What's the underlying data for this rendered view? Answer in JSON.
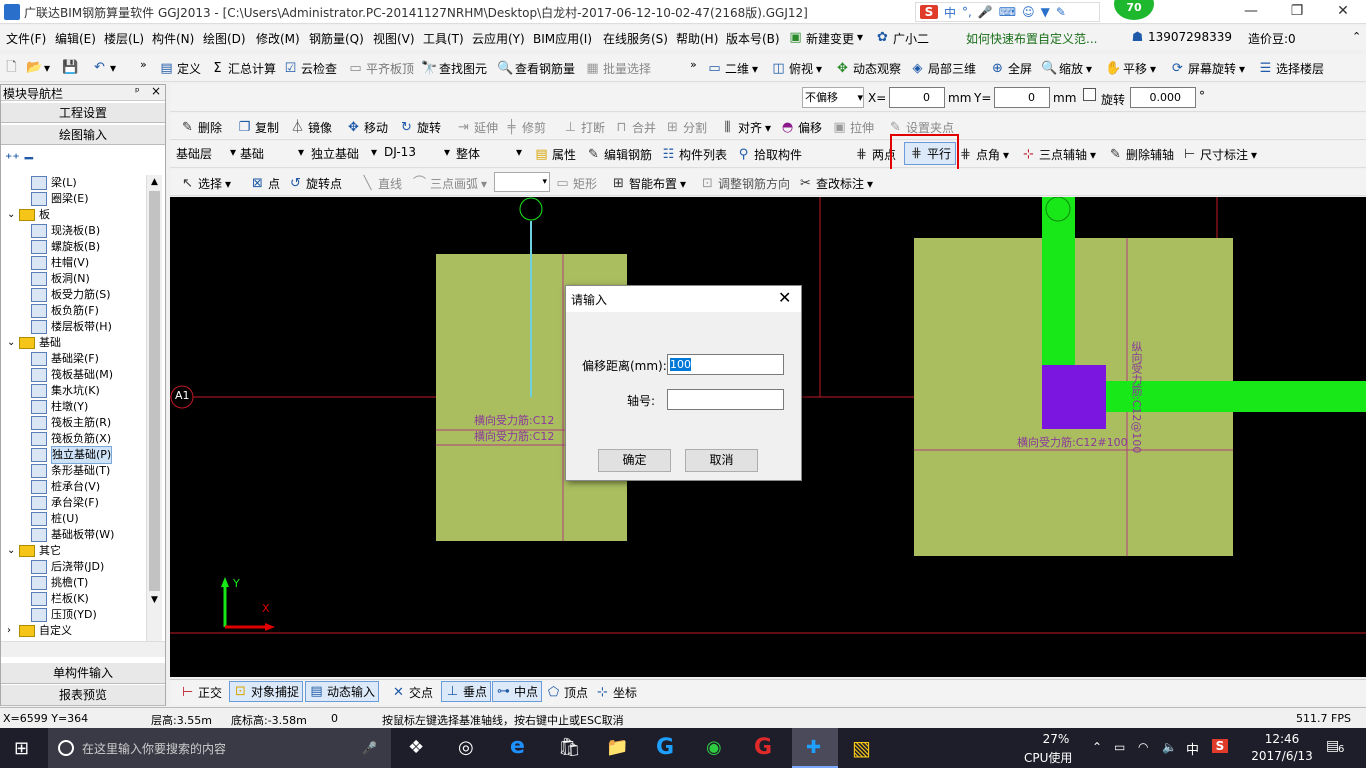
{
  "window": {
    "title": "广联达BIM钢筋算量软件 GGJ2013 - [C:\\Users\\Administrator.PC-20141127NRHM\\Desktop\\白龙村-2017-06-12-10-02-47(2168版).GGJ12]",
    "ime": "中",
    "badge": "70",
    "min": "—",
    "max": "❐",
    "close": "✕"
  },
  "menu": [
    "文件(F)",
    "编辑(E)",
    "楼层(L)",
    "构件(N)",
    "绘图(D)",
    "修改(M)",
    "钢筋量(Q)",
    "视图(V)",
    "工具(T)",
    "云应用(Y)",
    "BIM应用(I)",
    "在线服务(S)",
    "帮助(H)",
    "版本号(B)",
    "新建变更",
    "广小二",
    "如何快速布置自定义范...",
    "13907298339",
    "造价豆:0"
  ],
  "toolbar1": [
    "定义",
    "汇总计算",
    "云检查",
    "平齐板顶",
    "查找图元",
    "查看钢筋量",
    "批量选择",
    "二维",
    "俯视",
    "动态观察",
    "局部三维",
    "全屏",
    "缩放",
    "平移",
    "屏幕旋转",
    "选择楼层"
  ],
  "offsetbar": {
    "mode": "不偏移",
    "x_label": "X=",
    "x_value": "0",
    "unit1": "mm",
    "y_label": "Y=",
    "y_value": "0",
    "unit2": "mm",
    "rotate_label": "旋转",
    "rotate_value": "0.000",
    "deg": "°"
  },
  "toolbar2": [
    "删除",
    "复制",
    "镜像",
    "移动",
    "旋转",
    "延伸",
    "修剪",
    "打断",
    "合并",
    "分割",
    "对齐",
    "偏移",
    "拉伸",
    "设置夹点"
  ],
  "toolbar3": {
    "floor": "基础层",
    "category": "基础",
    "type": "独立基础",
    "element": "DJ-13",
    "whole": "整体",
    "items": [
      "属性",
      "编辑钢筋",
      "构件列表",
      "拾取构件",
      "两点",
      "平行",
      "点角",
      "三点辅轴",
      "删除辅轴",
      "尺寸标注"
    ]
  },
  "toolbar4": [
    "选择",
    "点",
    "旋转点",
    "直线",
    "三点画弧",
    "矩形",
    "智能布置",
    "调整钢筋方向",
    "查改标注"
  ],
  "sidebar": {
    "title": "模块导航栏",
    "pin": "ᵖ",
    "close": "×",
    "section1": "工程设置",
    "section2": "绘图输入",
    "bottom1": "单构件输入",
    "bottom2": "报表预览",
    "tree": [
      {
        "label": "梁(L)",
        "indent": 2
      },
      {
        "label": "圈梁(E)",
        "indent": 2
      },
      {
        "label": "板",
        "indent": 0,
        "folder": true
      },
      {
        "label": "现浇板(B)",
        "indent": 2
      },
      {
        "label": "螺旋板(B)",
        "indent": 2
      },
      {
        "label": "柱帽(V)",
        "indent": 2
      },
      {
        "label": "板洞(N)",
        "indent": 2
      },
      {
        "label": "板受力筋(S)",
        "indent": 2
      },
      {
        "label": "板负筋(F)",
        "indent": 2
      },
      {
        "label": "楼层板带(H)",
        "indent": 2
      },
      {
        "label": "基础",
        "indent": 0,
        "folder": true
      },
      {
        "label": "基础梁(F)",
        "indent": 2
      },
      {
        "label": "筏板基础(M)",
        "indent": 2
      },
      {
        "label": "集水坑(K)",
        "indent": 2
      },
      {
        "label": "柱墩(Y)",
        "indent": 2
      },
      {
        "label": "筏板主筋(R)",
        "indent": 2
      },
      {
        "label": "筏板负筋(X)",
        "indent": 2
      },
      {
        "label": "独立基础(P)",
        "indent": 2,
        "selected": true
      },
      {
        "label": "条形基础(T)",
        "indent": 2
      },
      {
        "label": "桩承台(V)",
        "indent": 2
      },
      {
        "label": "承台梁(F)",
        "indent": 2
      },
      {
        "label": "桩(U)",
        "indent": 2
      },
      {
        "label": "基础板带(W)",
        "indent": 2
      },
      {
        "label": "其它",
        "indent": 0,
        "folder": true
      },
      {
        "label": "后浇带(JD)",
        "indent": 2
      },
      {
        "label": "挑檐(T)",
        "indent": 2
      },
      {
        "label": "栏板(K)",
        "indent": 2
      },
      {
        "label": "压顶(YD)",
        "indent": 2
      },
      {
        "label": "自定义",
        "indent": 0,
        "folder": true
      }
    ]
  },
  "canvas": {
    "axis_a1": "A1",
    "rebar1": "横向受力筋:C12",
    "rebar2": "横向受力筋:C12",
    "rebar3": "横向受力筋:C12#100",
    "rebar4": "纵向受力筋:C12@100",
    "y_axis": "Y",
    "x_axis": "X"
  },
  "dialog": {
    "title": "请输入",
    "offset_label": "偏移距离(mm):",
    "offset_value": "100",
    "axis_label": "轴号:",
    "axis_value": "",
    "ok": "确定",
    "cancel": "取消"
  },
  "snapbar": [
    "正交",
    "对象捕捉",
    "动态输入",
    "交点",
    "垂点",
    "中点",
    "顶点",
    "坐标"
  ],
  "status": {
    "coords": "X=6599 Y=364",
    "floor_h": "层高:3.55m",
    "bottom_h": "底标高:-3.58m",
    "zero": "0",
    "hint": "按鼠标左键选择基准轴线，按右键中止或ESC取消",
    "fps": "511.7 FPS"
  },
  "taskbar": {
    "search": "在这里输入你要搜索的内容",
    "cpu": "27%",
    "cpu_label": "CPU使用",
    "time": "12:46",
    "date": "2017/6/13",
    "lang": "中",
    "notif": "6"
  },
  "colors": {
    "slab": "#aabd5f",
    "beam": "#18e818",
    "column": "#7a16e0",
    "axisline": "#c01a28",
    "highlight": "#e00000"
  }
}
